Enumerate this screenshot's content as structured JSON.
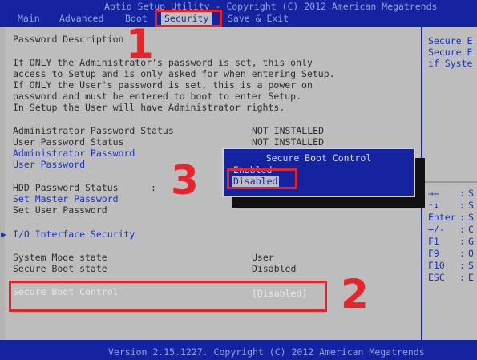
{
  "header": {
    "title": "Aptio Setup Utility - Copyright (C) 2012 American Megatrends",
    "tabs": [
      {
        "label": "Main",
        "active": false
      },
      {
        "label": "Advanced",
        "active": false
      },
      {
        "label": "Boot",
        "active": false
      },
      {
        "label": "Security",
        "active": true
      },
      {
        "label": "Save & Exit",
        "active": false
      }
    ]
  },
  "main": {
    "description_title": "Password Description",
    "description_lines": [
      "If ONLY the Administrator's password is set, this only",
      "access to Setup and is only asked for when entering Setup.",
      "If ONLY the User's password is set, this is a power on",
      "password and must be entered to boot to enter Setup.",
      "In Setup the User will have Administrator rights."
    ],
    "admin_pw_status": {
      "label": "Administrator Password Status",
      "value": "NOT INSTALLED"
    },
    "user_pw_status": {
      "label": "User Password Status",
      "value": "NOT INSTALLED"
    },
    "admin_pw_link": "Administrator Password",
    "user_pw_link": "User Password",
    "hdd_pw_status": {
      "label": "HDD Password Status",
      "sep": ":"
    },
    "set_master_pw": "Set Master Password",
    "set_user_pw": "Set User Password",
    "io_arrow": "▶",
    "io_security": "I/O Interface Security",
    "system_mode": {
      "label": "System Mode state",
      "value": "User"
    },
    "secure_boot_state": {
      "label": "Secure Boot state",
      "value": "Disabled"
    },
    "secure_boot_control": {
      "label": "Secure Boot Control",
      "value": "[Disabled]"
    }
  },
  "popup": {
    "title": "Secure Boot Control",
    "options": [
      {
        "label": "Enabled",
        "selected": false
      },
      {
        "label": "Disabled",
        "selected": true
      }
    ]
  },
  "help": {
    "lines": [
      "Secure E",
      "Secure E",
      "if Syste"
    ],
    "keys": [
      {
        "key": "→←",
        "sep": ":"
      },
      {
        "key": "↑↓",
        "sep": ":"
      },
      {
        "key": "Enter",
        "sep": ":"
      },
      {
        "key": "+/-",
        "sep": ":"
      },
      {
        "key": "F1",
        "sep": ":"
      },
      {
        "key": "F9",
        "sep": ":"
      },
      {
        "key": "F10",
        "sep": ":"
      },
      {
        "key": "ESC",
        "sep": ":"
      }
    ],
    "key_desc_initials": [
      "S",
      "S",
      "S",
      "C",
      "G",
      "O",
      "S",
      "E"
    ]
  },
  "footer": {
    "version": "Version 2.15.1227. Copyright (C) 2012 American Megatrends"
  },
  "annotations": {
    "step1": "1",
    "step2": "2",
    "step3": "3",
    "color": "#e8242a"
  },
  "colors": {
    "bios_blue": "#1424a0",
    "panel_gray": "#bdbdbd",
    "link_blue": "#1a34c0"
  }
}
